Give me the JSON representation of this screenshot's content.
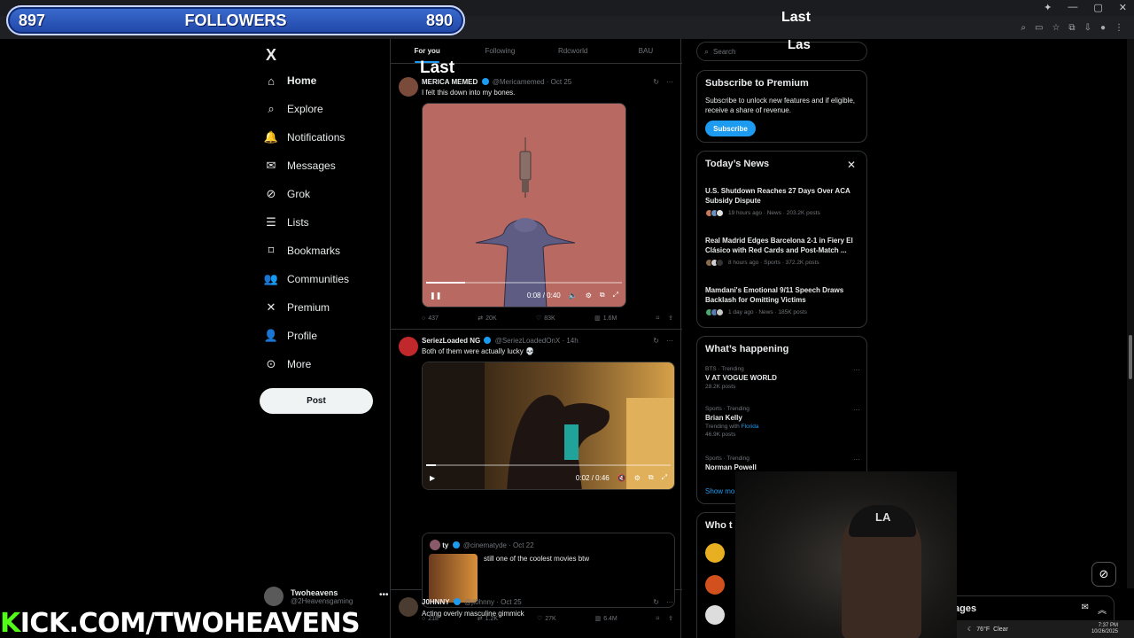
{
  "overlay": {
    "followers_current": "897",
    "followers_label": "FOLLOWERS",
    "followers_goal": "890",
    "last_text_1": "Last",
    "last_text_2": "Las",
    "last_text_3": "Last",
    "kick_k": "K",
    "kick_rest": "ICK.COM/TWOHEAVENS"
  },
  "nav": {
    "logo": "X",
    "items": [
      {
        "label": "Home",
        "icon": "home-icon"
      },
      {
        "label": "Explore",
        "icon": "search-icon"
      },
      {
        "label": "Notifications",
        "icon": "bell-icon"
      },
      {
        "label": "Messages",
        "icon": "envelope-icon"
      },
      {
        "label": "Grok",
        "icon": "grok-icon"
      },
      {
        "label": "Lists",
        "icon": "list-icon"
      },
      {
        "label": "Bookmarks",
        "icon": "bookmark-icon"
      },
      {
        "label": "Communities",
        "icon": "people-icon"
      },
      {
        "label": "Premium",
        "icon": "x-icon"
      },
      {
        "label": "Profile",
        "icon": "person-icon"
      },
      {
        "label": "More",
        "icon": "more-circle-icon"
      }
    ],
    "post_label": "Post",
    "account_name": "Twoheavens",
    "account_handle": "@2Heavensgaming"
  },
  "feed": {
    "tabs": [
      "For you",
      "Following",
      "Rdcworld",
      "BAU"
    ],
    "tweets": [
      {
        "name": "MERICA MEMED",
        "handle": "@Mericamemed",
        "time": "Oct 25",
        "text": "I felt this down into my bones.",
        "video_time": "0:08 / 0:40",
        "progress": 0.2,
        "replies": "437",
        "reposts": "20K",
        "likes": "83K",
        "views": "1.6M"
      },
      {
        "name": "SeriezLoaded NG",
        "handle": "@SeriezLoadedOnX",
        "time": "14h",
        "text": "Both of them were actually lucky 💀",
        "video_time": "0:02 / 0:46",
        "progress": 0.04,
        "quote": {
          "name": "ty",
          "handle": "@cinematyde",
          "time": "Oct 22",
          "text": "still one of the coolest movies btw"
        },
        "replies": "218",
        "reposts": "1.2K",
        "likes": "27K",
        "views": "6.4M"
      },
      {
        "name": "J0HNNY",
        "handle": "@jt0hnny",
        "time": "Oct 25",
        "text": "Acting overly masculine gimmick"
      }
    ]
  },
  "right": {
    "search_placeholder": "Search",
    "premium": {
      "title": "Subscribe to Premium",
      "desc": "Subscribe to unlock new features and if eligible, receive a share of revenue.",
      "button": "Subscribe"
    },
    "news": {
      "title": "Today’s News",
      "items": [
        {
          "title": "U.S. Shutdown Reaches 27 Days Over ACA Subsidy Dispute",
          "meta": "19 hours ago · News · 203.2K posts"
        },
        {
          "title": "Real Madrid Edges Barcelona 2-1 in Fiery El Clásico with Red Cards and Post-Match ...",
          "meta": "8 hours ago · Sports · 372.2K posts"
        },
        {
          "title": "Mamdani's Emotional 9/11 Speech Draws Backlash for Omitting Victims",
          "meta": "1 day ago · News · 185K posts"
        }
      ]
    },
    "happening": {
      "title": "What’s happening",
      "trends": [
        {
          "cat": "BTS · Trending",
          "name": "V AT VOGUE WORLD",
          "sub": "28.2K posts"
        },
        {
          "cat": "Sports · Trending",
          "name": "Brian Kelly",
          "sub_prefix": "Trending with ",
          "sub_link": "Florida",
          "sub2": "46.9K posts"
        },
        {
          "cat": "Sports · Trending",
          "name": "Norman Powell"
        }
      ],
      "show_more": "Show mo"
    },
    "who_to_follow": "Who t"
  },
  "drawer": {
    "label": "ages"
  },
  "taskbar": {
    "weather": "76°F",
    "weather_desc": "Clear",
    "time": "7:37 PM",
    "date": "10/26/2025"
  },
  "colors": {
    "accent": "#1d9bf0",
    "kick_green": "#53fc18",
    "followers_blue": "#2f5cc0"
  }
}
